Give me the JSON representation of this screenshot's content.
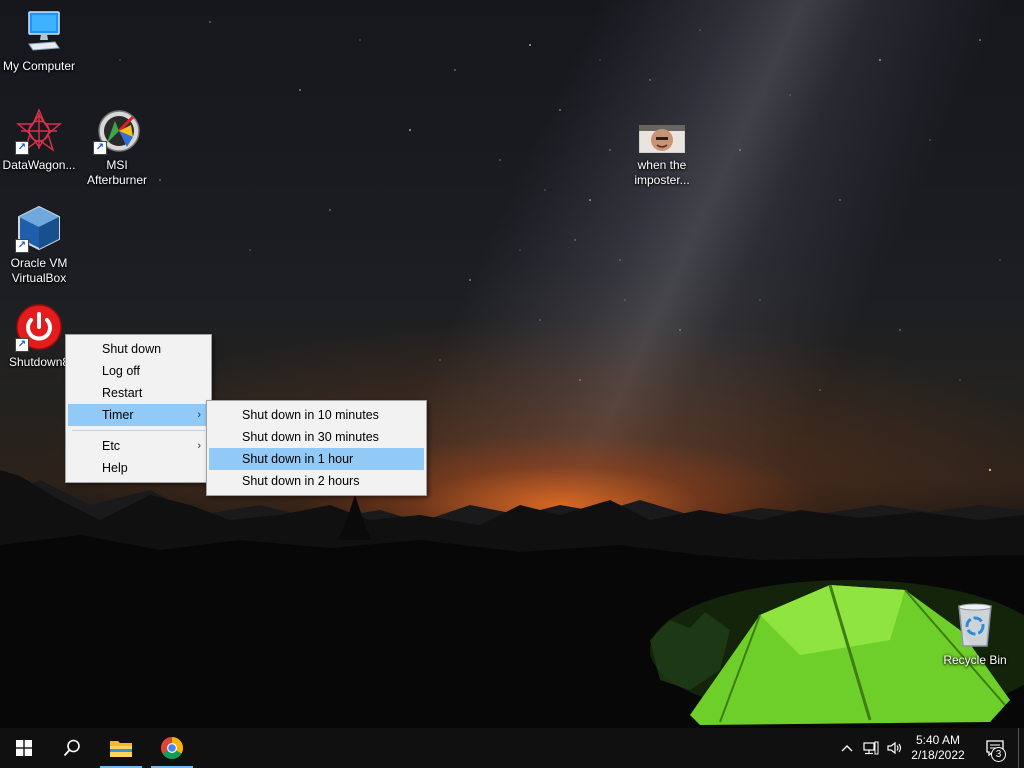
{
  "desktop": {
    "icons": [
      {
        "id": "my-computer",
        "label": "My Computer"
      },
      {
        "id": "datawagon",
        "label": "DataWagon..."
      },
      {
        "id": "msi-afterburner",
        "label_line1": "MSI",
        "label_line2": "Afterburner"
      },
      {
        "id": "virtualbox",
        "label_line1": "Oracle VM",
        "label_line2": "VirtualBox"
      },
      {
        "id": "shutdown8",
        "label": "Shutdown8"
      },
      {
        "id": "imposter",
        "label_line1": "when the",
        "label_line2": "imposter..."
      },
      {
        "id": "recycle-bin",
        "label": "Recycle Bin"
      }
    ]
  },
  "context_menu": {
    "items": [
      {
        "label": "Shut down",
        "submenu": false
      },
      {
        "label": "Log off",
        "submenu": false
      },
      {
        "label": "Restart",
        "submenu": false
      },
      {
        "label": "Timer",
        "submenu": true,
        "active": true
      },
      {
        "label": "Etc",
        "submenu": true
      },
      {
        "label": "Help",
        "submenu": false
      }
    ],
    "submenu_arrow": "›"
  },
  "timer_submenu": {
    "items": [
      {
        "label": "Shut down in 10 minutes"
      },
      {
        "label": "Shut down in 30 minutes"
      },
      {
        "label": "Shut down in 1 hour",
        "active": true
      },
      {
        "label": "Shut down in 2 hours"
      }
    ]
  },
  "taskbar": {
    "clock_time": "5:40 AM",
    "clock_date": "2/18/2022",
    "notification_count": "3",
    "pinned": [
      "start-icon",
      "search-icon",
      "file-explorer-icon",
      "chrome-icon"
    ]
  },
  "colors": {
    "menu_bg": "#f2f2f2",
    "menu_highlight": "#91c9f7",
    "taskbar_bg": "#101010",
    "running_indicator": "#76b9ed"
  }
}
